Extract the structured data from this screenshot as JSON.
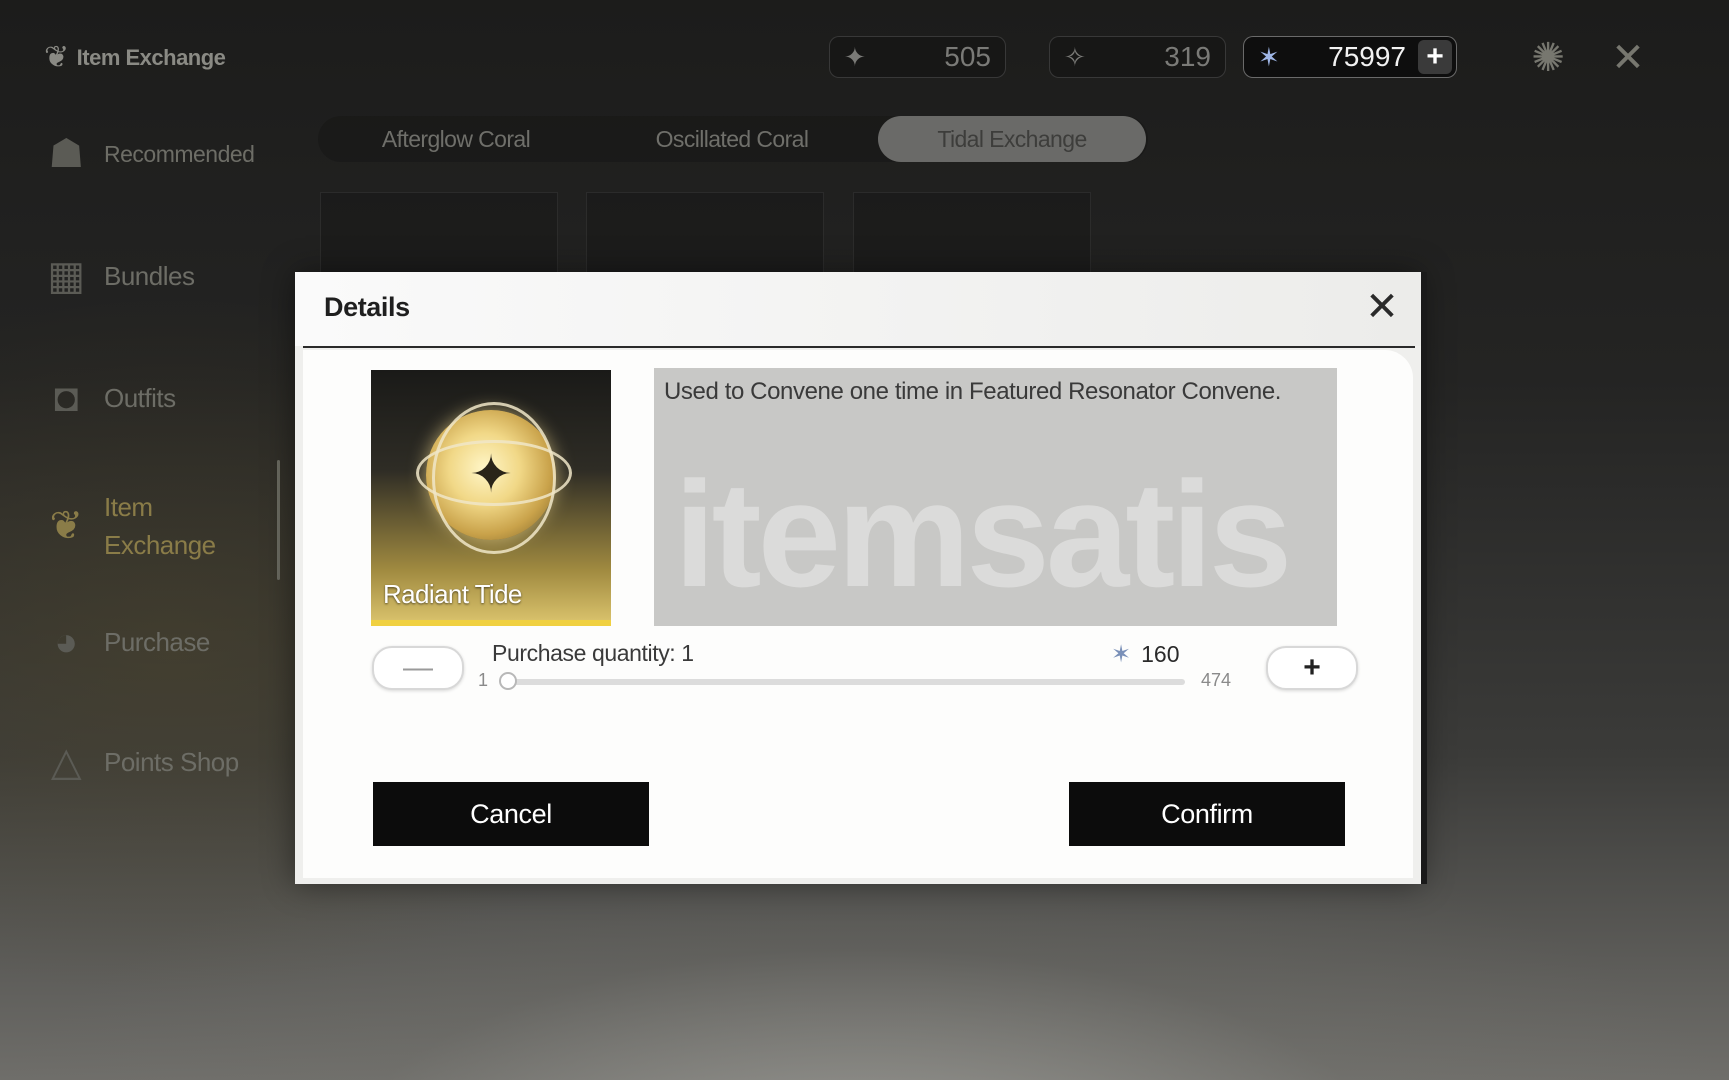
{
  "header": {
    "title": "Item Exchange",
    "currencies": [
      {
        "icon": "afterglow-coral-icon",
        "value": "505"
      },
      {
        "icon": "oscillated-coral-icon",
        "value": "319"
      },
      {
        "icon": "astrite-icon",
        "value": "75997",
        "add_label": "+"
      }
    ]
  },
  "tabs": [
    {
      "label": "Afterglow Coral",
      "active": false
    },
    {
      "label": "Oscillated Coral",
      "active": false
    },
    {
      "label": "Tidal Exchange",
      "active": true
    }
  ],
  "sidebar": {
    "items": [
      {
        "label": "Recommended",
        "icon": "recommended-icon"
      },
      {
        "label": "Bundles",
        "icon": "gift-icon"
      },
      {
        "label": "Outfits",
        "icon": "shirt-icon"
      },
      {
        "label": "Item Exchange",
        "icon": "tree-icon",
        "active": true
      },
      {
        "label": "Purchase",
        "icon": "purchase-icon"
      },
      {
        "label": "Points Shop",
        "icon": "triangle-icon"
      }
    ]
  },
  "modal": {
    "title": "Details",
    "item": {
      "name": "Radiant Tide",
      "description": "Used to Convene one time in Featured Resonator Convene."
    },
    "watermark": "itemsatis",
    "quantity": {
      "label": "Purchase quantity: 1",
      "value": 1,
      "min": "1",
      "max": "474",
      "price": "160",
      "minus_label": "—",
      "plus_label": "+"
    },
    "buttons": {
      "cancel": "Cancel",
      "confirm": "Confirm"
    }
  },
  "colors": {
    "accent_gold": "#f0d040",
    "button_black": "#0c0c0c",
    "modal_bg": "#efefed"
  }
}
